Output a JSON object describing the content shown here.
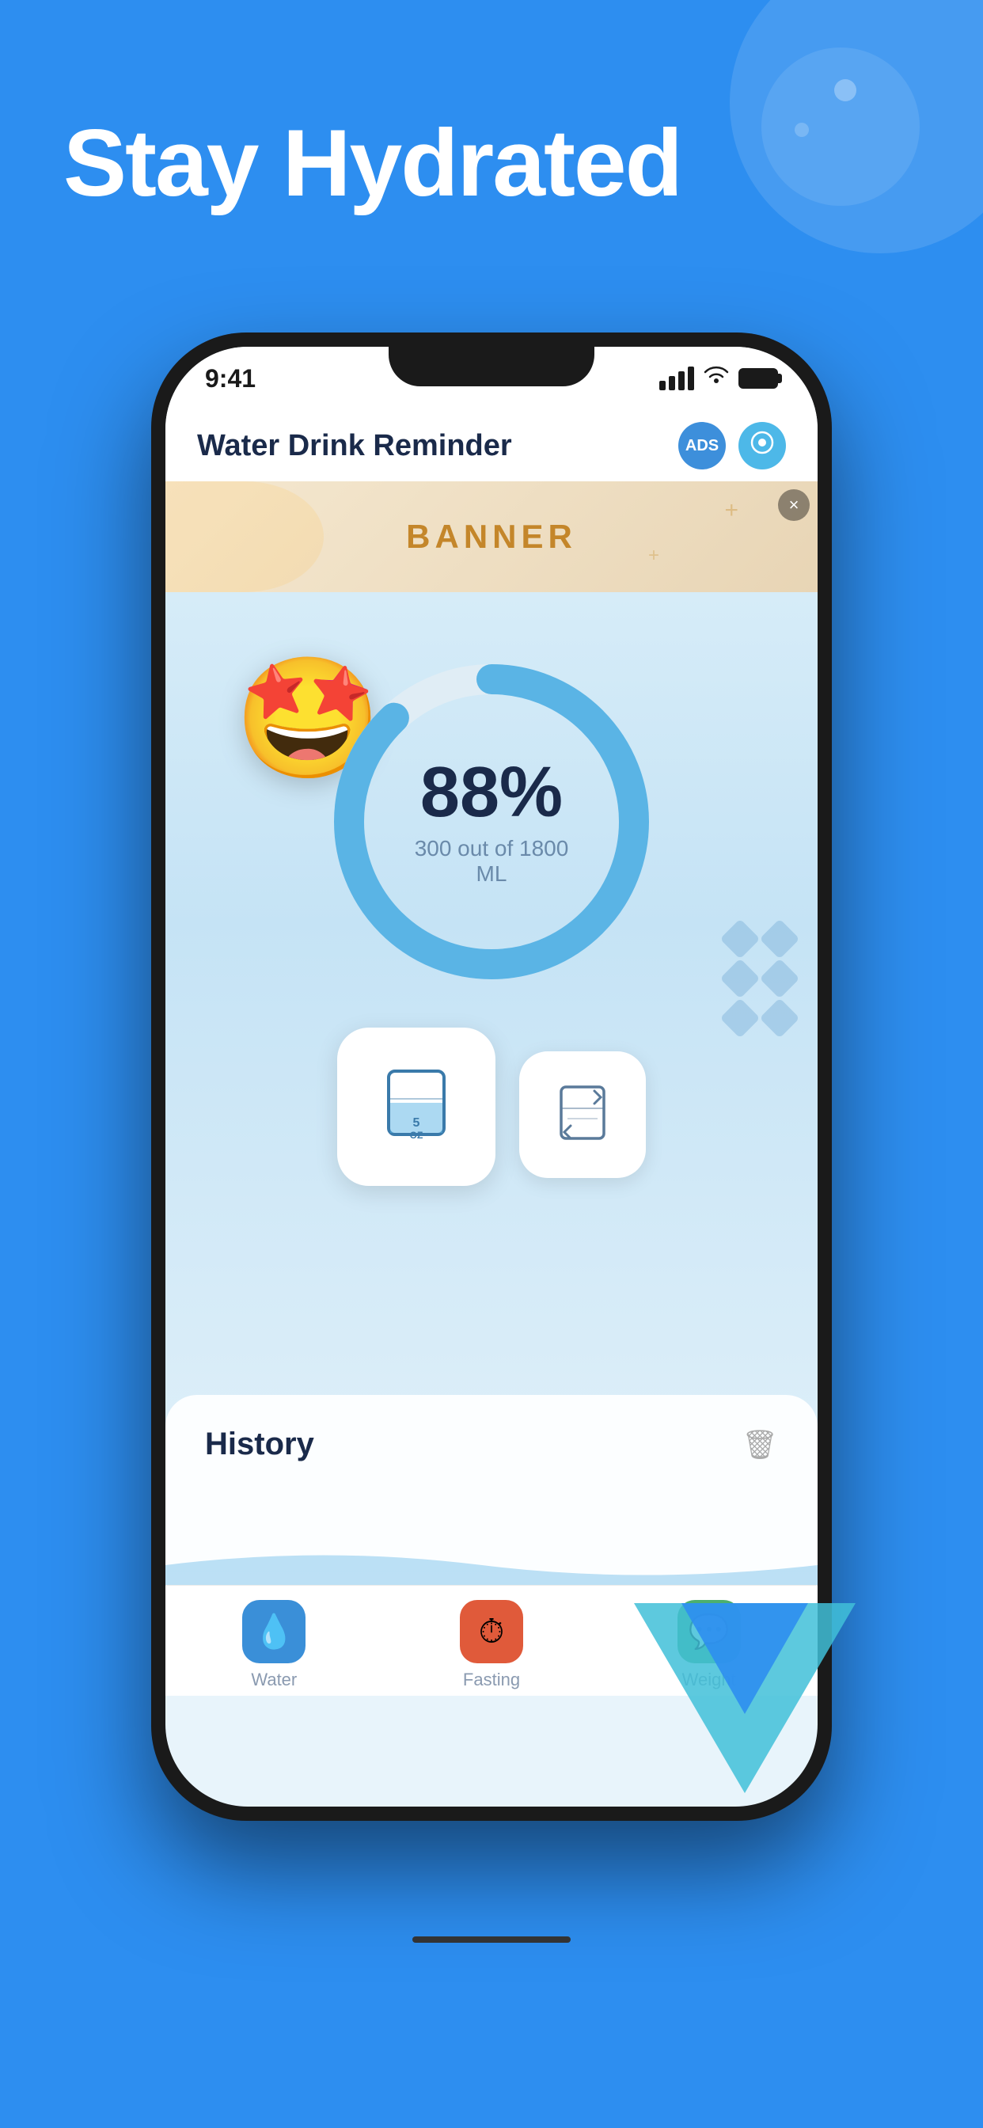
{
  "page": {
    "background_color": "#2d8ef0",
    "title": "Stay Hydrated"
  },
  "app": {
    "name": "Water Drink Reminder",
    "status_bar": {
      "time": "9:41"
    },
    "header": {
      "title": "Water Drink Reminder",
      "ads_button": "ADS",
      "settings_button": "○"
    },
    "banner": {
      "text": "BANNER",
      "close": "×"
    },
    "progress": {
      "percent": "88%",
      "detail": "300 out of 1800 ML",
      "value": 88,
      "current_ml": 300,
      "total_ml": 1800
    },
    "drink_primary": {
      "label": "5\nOZ"
    },
    "history": {
      "title": "History"
    },
    "tabs": [
      {
        "id": "water",
        "label": "Water",
        "icon": "💧",
        "active": true
      },
      {
        "id": "fasting",
        "label": "Fasting",
        "icon": "⏱",
        "active": false
      },
      {
        "id": "weight",
        "label": "Weight",
        "icon": "💬",
        "active": false
      }
    ]
  }
}
